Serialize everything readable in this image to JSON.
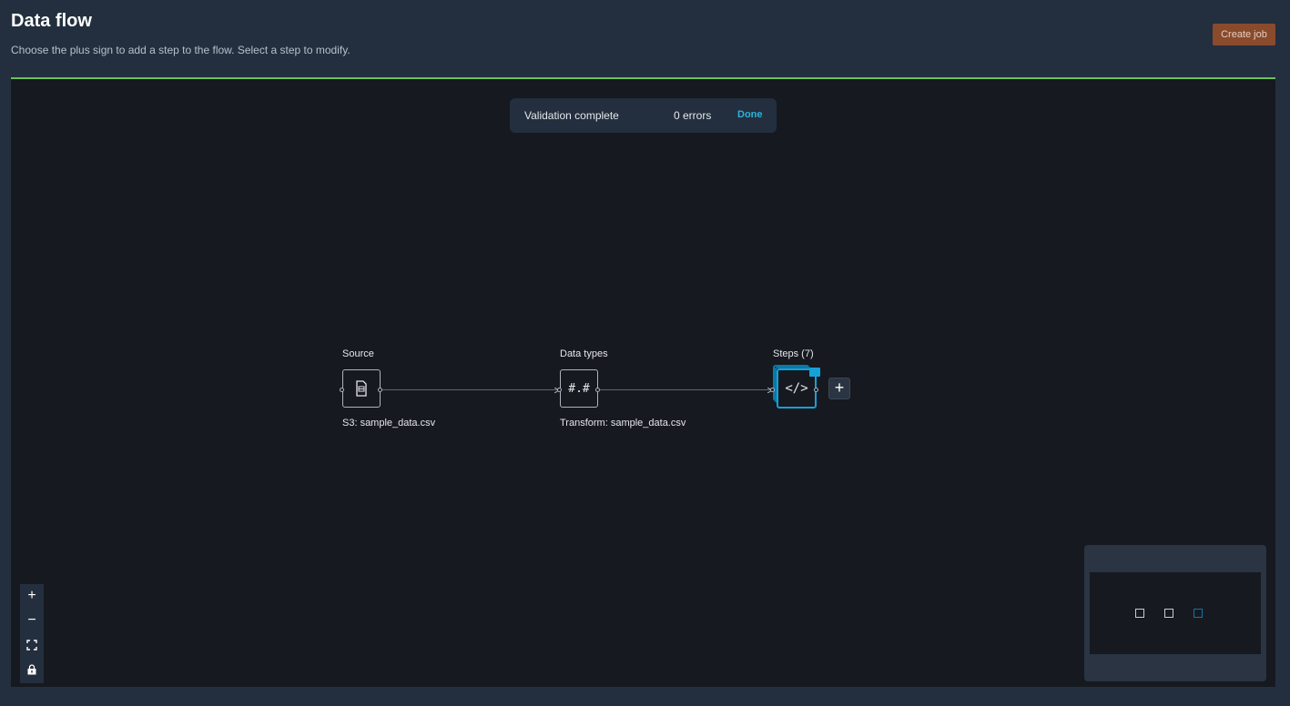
{
  "header": {
    "title": "Data flow",
    "subtitle": "Choose the plus sign to add a step to the flow. Select a step to modify.",
    "create_job_label": "Create job"
  },
  "validation": {
    "title": "Validation complete",
    "errors_text": "0 errors",
    "done_label": "Done"
  },
  "nodes": {
    "source": {
      "label": "Source",
      "caption": "S3: sample_data.csv",
      "icon": "document-icon"
    },
    "data_types": {
      "label": "Data types",
      "caption": "Transform: sample_data.csv",
      "glyph": "#.#",
      "icon": "number-format-icon"
    },
    "steps": {
      "label": "Steps (7)",
      "glyph": "</>",
      "icon": "code-icon"
    }
  },
  "add_step_label": "+",
  "zoom_controls": {
    "zoom_in": "+",
    "zoom_out": "−",
    "fit_icon": "fit-view-icon",
    "lock_icon": "lock-icon"
  },
  "colors": {
    "background": "#232f3e",
    "canvas": "#16191f",
    "accent": "#16a0d8",
    "success_border": "#6ec15a",
    "primary_button": "#8a4a2c"
  }
}
